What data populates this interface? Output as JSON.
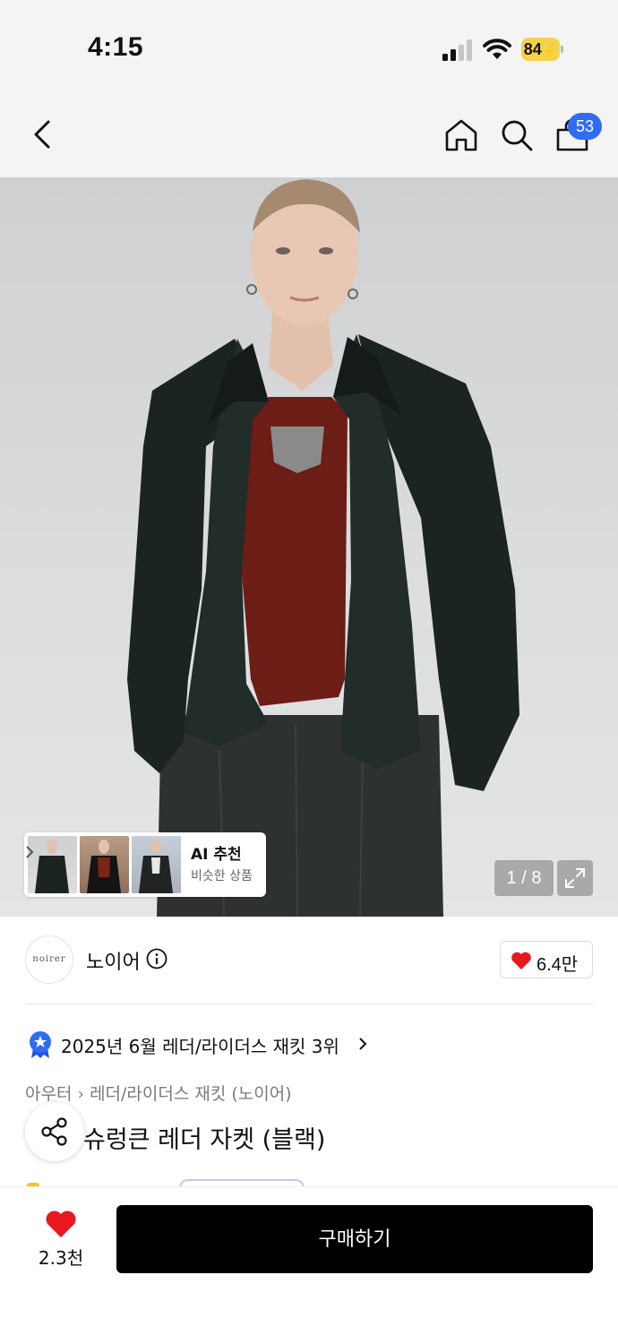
{
  "status_bar": {
    "time": "4:15",
    "battery_level": "84",
    "battery_charging": true,
    "battery_color": "#f5d24b"
  },
  "nav": {
    "back_icon": "chevron-left-icon",
    "home_icon": "home-icon",
    "search_icon": "search-icon",
    "cart_icon": "shopping-bag-icon",
    "cart_count": "53",
    "badge_color": "#2f6cf5"
  },
  "gallery": {
    "current_page": "1",
    "total_pages": "8",
    "page_label": "1 / 8",
    "expand_icon": "expand-icon",
    "ai_recommend": {
      "title": "AI 추천",
      "subtitle": "비슷한 상품"
    }
  },
  "brand": {
    "logo_text": "noirer",
    "name": "노이어",
    "info_icon": "info-icon",
    "likes": "6.4만",
    "like_color": "#e8191d"
  },
  "ranking": {
    "icon": "ranking-badge-icon",
    "text": "2025년 6월 레더/라이더스 재킷 3위"
  },
  "breadcrumb": {
    "items": [
      "아우터",
      "레더/라이더스 재킷 (노이어)"
    ]
  },
  "product": {
    "title": "슈렁큰 레더 자켓 (블랙)"
  },
  "bottom_bar": {
    "wish_count": "2.3천",
    "buy_label": "구매하기",
    "heart_color": "#e8191d"
  }
}
